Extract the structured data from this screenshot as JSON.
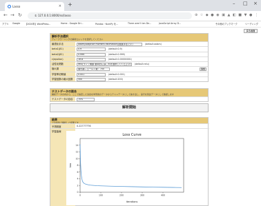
{
  "browser": {
    "tab_title": "Lasso",
    "url": "① 127.0.0.1:8000/ss/lasso",
    "bookmarks": [
      "アプリ",
      "Google",
      "【2020年】WordPress...",
      "Home - Google Dri...",
      "Pandas・NumPy を...",
      "There aren't ten De...",
      "JavaScript Array D..."
    ],
    "bookmarks_right": "その他のブックマーク",
    "bookmarks_reading": "リーディング"
  },
  "page": {
    "return_label": "戻る画面",
    "params": {
      "title": "解析手法選択",
      "subtitle": "ディープラーニングの解析ロジックを選択してください",
      "rows": [
        {
          "label": "最適化手法",
          "value": "adam(Adaptive moment estimation)(推奨手法です)",
          "hint": "(default:adam)"
        },
        {
          "label": "beta1(β1)",
          "value": "0.9",
          "hint": "(default:0.9)"
        },
        {
          "label": "beta2(β2)",
          "value": "0.999",
          "hint": "(default:0.999)"
        },
        {
          "label": "ε(epsilon)",
          "value": "1e-8",
          "hint": "(default:0.00000001)"
        },
        {
          "label": "活性化関数",
          "value": "relu(ランプ関数 基本的にはこれを選択してください)",
          "hint": "(default:relu)"
        },
        {
          "label": "隠れ層",
          "value": "隠れ層ニューロン数：700",
          "hint": "",
          "button": "追加"
        },
        {
          "label": "学習率初期値",
          "value": "0.001",
          "hint": "(default:0.001)"
        },
        {
          "label": "学習回数の最大回数",
          "value": "500",
          "hint": "(default:200)"
        }
      ]
    },
    "testdata": {
      "title": "テストデータの割合",
      "subtitle": "解析データの内から、ここで指定した割合を学習用のデータからテストデータとして抜き出し、実行を別途データとして確認します",
      "label": "テストデータの割合",
      "value": "70%"
    },
    "run_label": "解析開始",
    "result": {
      "title": "結果",
      "subtitle": "上の条件で解析した結果です",
      "score_label": "予測精度",
      "score_value": "0.22777776",
      "curve_label": "学習曲線"
    }
  },
  "chart_data": {
    "type": "line",
    "title": "Loss Curve",
    "xlabel": "iterations",
    "ylabel": "loss",
    "xlim": [
      0,
      500
    ],
    "ylim": [
      0,
      16
    ],
    "xticks": [
      0,
      100,
      200,
      300,
      400
    ],
    "yticks": [
      0,
      2,
      4,
      6,
      8,
      10,
      12,
      14
    ],
    "grid": false,
    "color": "#5b9bd5",
    "series": [
      {
        "x": [
          0,
          2,
          4,
          6,
          8,
          10,
          12,
          15,
          20,
          25,
          30,
          40,
          50,
          60,
          80,
          100,
          150,
          200,
          250,
          300,
          350,
          400,
          450,
          490
        ],
        "values": [
          14.3,
          9.0,
          6.5,
          5.0,
          4.2,
          3.6,
          3.2,
          2.9,
          2.6,
          2.45,
          2.35,
          2.2,
          2.1,
          2.05,
          1.95,
          1.9,
          1.8,
          1.72,
          1.65,
          1.58,
          1.52,
          1.47,
          1.42,
          1.38
        ]
      }
    ]
  }
}
